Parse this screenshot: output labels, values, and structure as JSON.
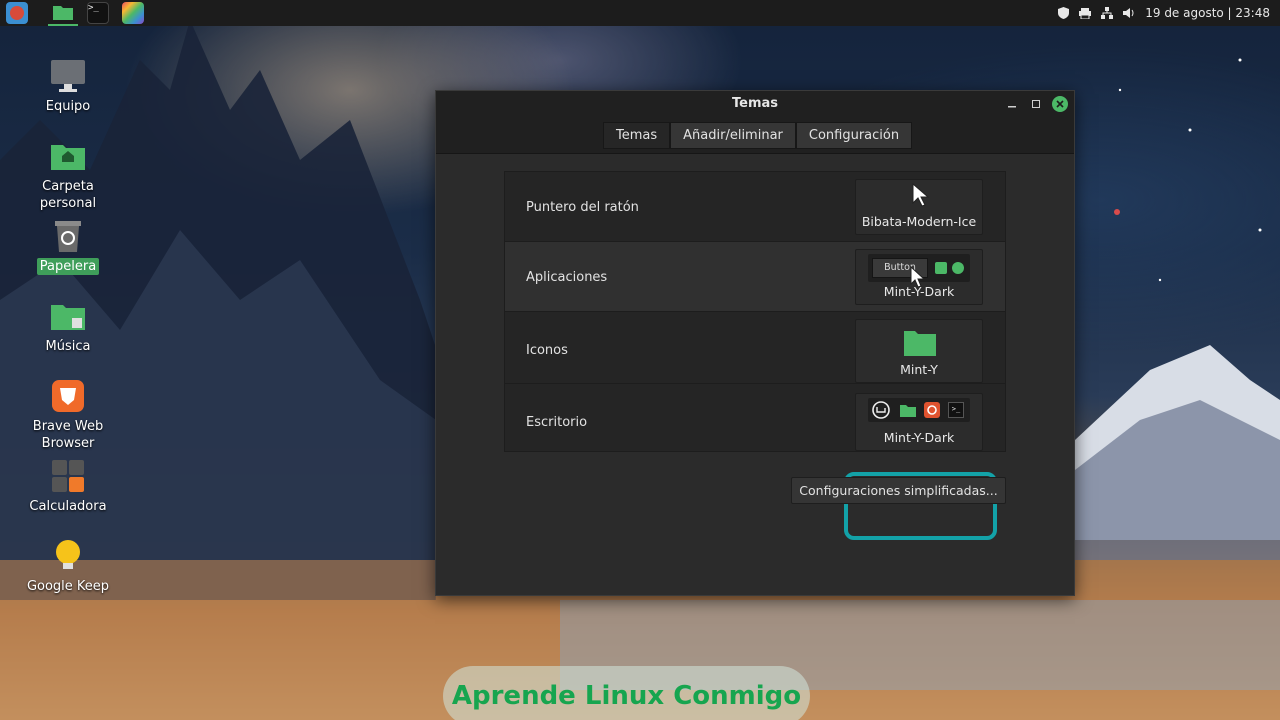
{
  "panel": {
    "launchers": [
      {
        "icon": "menu-icon",
        "color": "#d74b3a"
      },
      {
        "icon": "files-icon",
        "color": "#4cb867"
      },
      {
        "icon": "terminal-icon",
        "color": "#2a2a2a"
      },
      {
        "icon": "paint-icon",
        "color": "#8a48c9"
      }
    ],
    "tray": {
      "shield": "shield-icon",
      "printer": "printer-icon",
      "network": "network-icon",
      "volume": "volume-icon",
      "clock": "19 de agosto | 23:48"
    }
  },
  "desktop": {
    "icons": [
      {
        "label": "Equipo",
        "icon": "computer-icon"
      },
      {
        "label": "Carpeta personal",
        "icon": "home-folder-icon"
      },
      {
        "label": "Papelera",
        "icon": "trash-icon"
      },
      {
        "label": "Música",
        "icon": "music-folder-icon"
      },
      {
        "label": "Brave Web Browser",
        "icon": "brave-icon"
      },
      {
        "label": "Calculadora",
        "icon": "calculator-icon"
      },
      {
        "label": "Google Keep",
        "icon": "keep-icon"
      }
    ]
  },
  "window": {
    "title": "Temas",
    "tabs": [
      "Temas",
      "Añadir/eliminar",
      "Configuración"
    ],
    "rows": [
      {
        "label": "Puntero del ratón",
        "value": "Bibata-Modern-Ice"
      },
      {
        "label": "Aplicaciones",
        "value": "Mint-Y-Dark",
        "sample_button": "Button"
      },
      {
        "label": "Iconos",
        "value": "Mint-Y"
      },
      {
        "label": "Escritorio",
        "value": "Mint-Y-Dark"
      }
    ],
    "simple_settings": "Configuraciones simplificadas..."
  },
  "watermark": "Aprende Linux Conmigo",
  "colors": {
    "accent": "#4cb867",
    "highlight": "#13a2a8"
  }
}
